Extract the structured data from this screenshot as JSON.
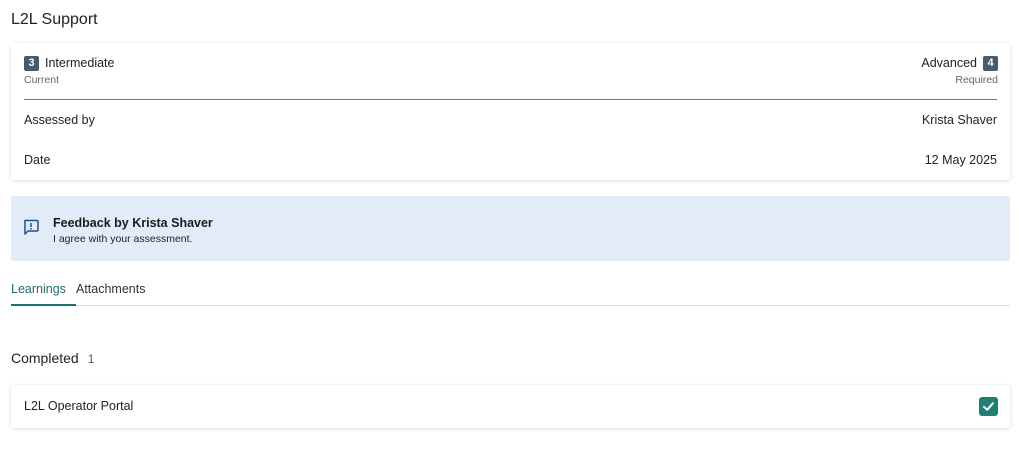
{
  "page": {
    "title": "L2L Support"
  },
  "level": {
    "current": {
      "number": "3",
      "name": "Intermediate",
      "caption": "Current"
    },
    "required": {
      "number": "4",
      "name": "Advanced",
      "caption": "Required"
    }
  },
  "details": {
    "assessed_by_label": "Assessed by",
    "assessed_by_value": "Krista Shaver",
    "date_label": "Date",
    "date_value": "12 May 2025"
  },
  "feedback": {
    "icon": "comment-alert-icon",
    "title": "Feedback by Krista Shaver",
    "text": "I agree with your assessment.",
    "background": "#e2ecf8"
  },
  "tabs": [
    {
      "label": "Learnings",
      "active": true
    },
    {
      "label": "Attachments",
      "active": false
    }
  ],
  "completed": {
    "heading": "Completed",
    "count": "1",
    "items": [
      {
        "name": "L2L Operator Portal",
        "checked": true,
        "icon": "checkmark-icon"
      }
    ]
  },
  "colors": {
    "accent": "#1f6f6a",
    "check": "#1f7f72",
    "badge": "#4a5a66"
  }
}
